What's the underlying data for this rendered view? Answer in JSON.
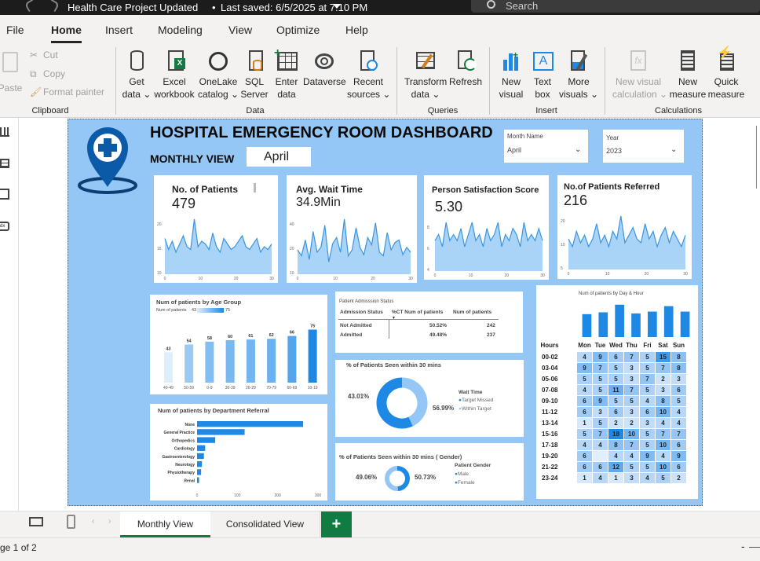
{
  "titlebar": {
    "title": "Health Care Project Updated",
    "separator": "•",
    "saved": "Last saved: 6/5/2025 at 7:10 PM",
    "search_placeholder": "Search"
  },
  "ribbon_tabs": [
    "File",
    "Home",
    "Insert",
    "Modeling",
    "View",
    "Optimize",
    "Help"
  ],
  "ribbon": {
    "clipboard": {
      "paste": "Paste",
      "cut": "Cut",
      "copy": "Copy",
      "format_painter": "Format painter",
      "group": "Clipboard"
    },
    "data": {
      "get_data": [
        "Get",
        "data"
      ],
      "excel": [
        "Excel",
        "workbook"
      ],
      "onelake": [
        "OneLake",
        "catalog"
      ],
      "sql": [
        "SQL",
        "Server"
      ],
      "enter": [
        "Enter",
        "data"
      ],
      "dataverse": "Dataverse",
      "recent": [
        "Recent",
        "sources"
      ],
      "group": "Data"
    },
    "queries": {
      "transform": [
        "Transform",
        "data"
      ],
      "refresh": "Refresh",
      "group": "Queries"
    },
    "insert": {
      "new_visual": [
        "New",
        "visual"
      ],
      "text_box": [
        "Text",
        "box"
      ],
      "more_visuals": [
        "More",
        "visuals"
      ],
      "group": "Insert"
    },
    "calculations": {
      "new_visual_calc": [
        "New visual",
        "calculation"
      ],
      "new_measure": [
        "New",
        "measure"
      ],
      "quick_measure": [
        "Quick",
        "measure"
      ],
      "group": "Calculations"
    }
  },
  "report": {
    "title": "HOSPITAL EMERGENCY ROOM DASHBOARD",
    "subtitle": "MONTHLY VIEW",
    "month_value": "April",
    "slicers": [
      {
        "label": "Month Name",
        "value": "April"
      },
      {
        "label": "Year",
        "value": "2023"
      }
    ],
    "kpis": [
      {
        "title": "No. of Patients",
        "value": "479"
      },
      {
        "title": "Avg. Wait Time",
        "value": "34.9Min"
      },
      {
        "title": "Person Satisfaction Score",
        "value": "5.30"
      },
      {
        "title": "No.of Patients  Referred",
        "value": "216"
      }
    ],
    "kpi_axes": [
      {
        "x": [
          "0",
          "10",
          "20",
          "30"
        ],
        "y": [
          "20",
          "15",
          "10"
        ]
      },
      {
        "x": [
          "0",
          "10",
          "20",
          "30"
        ],
        "y": [
          "40",
          "20",
          "10"
        ]
      },
      {
        "x": [
          "0",
          "10",
          "20",
          "30"
        ],
        "y": [
          "8",
          "6",
          "4"
        ]
      },
      {
        "x": [
          "0",
          "10",
          "20",
          "30"
        ],
        "y": [
          "20",
          "10",
          "5"
        ]
      }
    ],
    "admission": {
      "title": "Patient Admisssion Status",
      "headers": [
        "Admission Status",
        "%CT Num of patients",
        "Num of patients"
      ],
      "rows": [
        [
          "Not Admitted",
          "50.52%",
          "242"
        ],
        [
          "Admitted",
          "49.48%",
          "237"
        ]
      ]
    },
    "wait": {
      "title": "% of Patients Seen within 30 mins",
      "missed_pct": "43.01%",
      "within_pct": "56.99%",
      "legend_title": "Wait Time",
      "legend": [
        "Target Missed",
        "Within Target"
      ]
    },
    "gender": {
      "title": "% of Patients Seen within 30 mins ( Gender)",
      "left_pct": "49.06%",
      "right_pct": "50.73%",
      "legend_title": "Patient Gender",
      "legend": [
        "Male",
        "Female"
      ]
    },
    "heatmap_title": "Num of patients by Day & Hour",
    "heatmap_days": [
      "Mon",
      "Tue",
      "Wed",
      "Thu",
      "Fri",
      "Sat",
      "Sun"
    ],
    "heatmap_hours_label": "Hours",
    "heatmap_rows": [
      {
        "h": "00-02",
        "v": [
          "4",
          "9",
          "6",
          "7",
          "5",
          "15",
          "8"
        ]
      },
      {
        "h": "03-04",
        "v": [
          "9",
          "7",
          "5",
          "3",
          "5",
          "7",
          "8"
        ]
      },
      {
        "h": "05-06",
        "v": [
          "5",
          "5",
          "5",
          "3",
          "7",
          "2",
          "3"
        ]
      },
      {
        "h": "07-08",
        "v": [
          "4",
          "5",
          "11",
          "7",
          "5",
          "3",
          "6"
        ]
      },
      {
        "h": "09-10",
        "v": [
          "6",
          "9",
          "5",
          "5",
          "4",
          "8",
          "5"
        ]
      },
      {
        "h": "11-12",
        "v": [
          "6",
          "3",
          "6",
          "3",
          "6",
          "10",
          "4"
        ]
      },
      {
        "h": "13-14",
        "v": [
          "1",
          "5",
          "2",
          "2",
          "3",
          "4",
          "4"
        ]
      },
      {
        "h": "15-16",
        "v": [
          "5",
          "7",
          "18",
          "10",
          "5",
          "7",
          "7"
        ]
      },
      {
        "h": "17-18",
        "v": [
          "4",
          "4",
          "8",
          "7",
          "5",
          "10",
          "6"
        ]
      },
      {
        "h": "19-20",
        "v": [
          "6",
          "",
          "4",
          "4",
          "9",
          "4",
          "9"
        ]
      },
      {
        "h": "21-22",
        "v": [
          "6",
          "6",
          "12",
          "5",
          "5",
          "10",
          "6"
        ]
      },
      {
        "h": "23-24",
        "v": [
          "1",
          "4",
          "1",
          "3",
          "4",
          "5",
          "2"
        ]
      }
    ],
    "colors": {
      "accent": "#1e88e5",
      "light": "#94c7f5",
      "dark": "#0b4c8a",
      "kpi_fill": "#a9d3f7",
      "kpi_line": "#3a95e0"
    }
  },
  "chart_data": [
    {
      "type": "bar",
      "title": "Num of patients by Age Group",
      "legend_label": "Num of patients",
      "legend_min": "43",
      "legend_max": "75",
      "categories": [
        "40-49",
        "50-59",
        "0-9",
        "30-39",
        "20-29",
        "70-79",
        "60-69",
        "10-19"
      ],
      "values": [
        43,
        54,
        58,
        60,
        61,
        62,
        66,
        75
      ]
    },
    {
      "type": "bar",
      "title": "Num of patients by Department Referral",
      "orientation": "horizontal",
      "categories": [
        "None",
        "General Practice",
        "Orthopedics",
        "Cardiology",
        "Gastroenterology",
        "Neurology",
        "Physiotherapy",
        "Renal"
      ],
      "values": [
        263,
        118,
        45,
        20,
        17,
        12,
        10,
        5
      ],
      "xticks": [
        "0",
        "100",
        "200",
        "300"
      ],
      "xlim": [
        0,
        300
      ]
    },
    {
      "type": "bar",
      "title": "Num of patients by Day & Hour",
      "categories": [
        "Mon",
        "Tue",
        "Wed",
        "Thu",
        "Fri",
        "Sat",
        "Sun"
      ],
      "values": [
        63,
        68,
        89,
        65,
        70,
        85,
        70
      ]
    },
    {
      "type": "pie",
      "title": "% of Patients Seen within 30 mins",
      "categories": [
        "Target Missed",
        "Within Target"
      ],
      "values": [
        43.01,
        56.99
      ]
    },
    {
      "type": "pie",
      "title": "% of Patients Seen within 30 mins ( Gender)",
      "categories": [
        "Male",
        "Female"
      ],
      "values": [
        49.06,
        50.73
      ]
    }
  ],
  "kpi_series": [
    [
      13,
      9,
      12,
      8,
      11,
      14,
      10,
      9,
      20,
      10,
      12,
      11,
      9,
      15,
      10,
      8,
      13,
      11,
      9,
      10,
      12,
      14,
      10,
      9,
      11,
      13,
      8,
      10,
      9,
      11
    ],
    [
      20,
      15,
      28,
      12,
      35,
      18,
      22,
      40,
      10,
      25,
      30,
      18,
      45,
      15,
      20,
      38,
      22,
      16,
      30,
      24,
      42,
      18,
      15,
      34,
      20,
      26,
      28,
      16,
      22,
      18
    ],
    [
      5,
      6,
      4,
      8,
      5,
      6,
      5,
      7,
      4,
      6,
      8,
      5,
      6,
      4,
      7,
      5,
      6,
      8,
      4,
      6,
      5,
      7,
      6,
      4,
      8,
      5,
      6,
      5,
      7,
      5
    ],
    [
      8,
      6,
      10,
      7,
      9,
      6,
      8,
      12,
      7,
      9,
      6,
      10,
      8,
      14,
      7,
      9,
      11,
      8,
      7,
      12,
      8,
      10,
      6,
      9,
      11,
      7,
      10,
      8,
      6,
      9
    ]
  ],
  "tabs": {
    "monthly": "Monthly View",
    "consolidated": "Consolidated View",
    "add": "+"
  },
  "status": {
    "page": "ge 1 of 2",
    "minus": "-",
    "plus": "+"
  }
}
